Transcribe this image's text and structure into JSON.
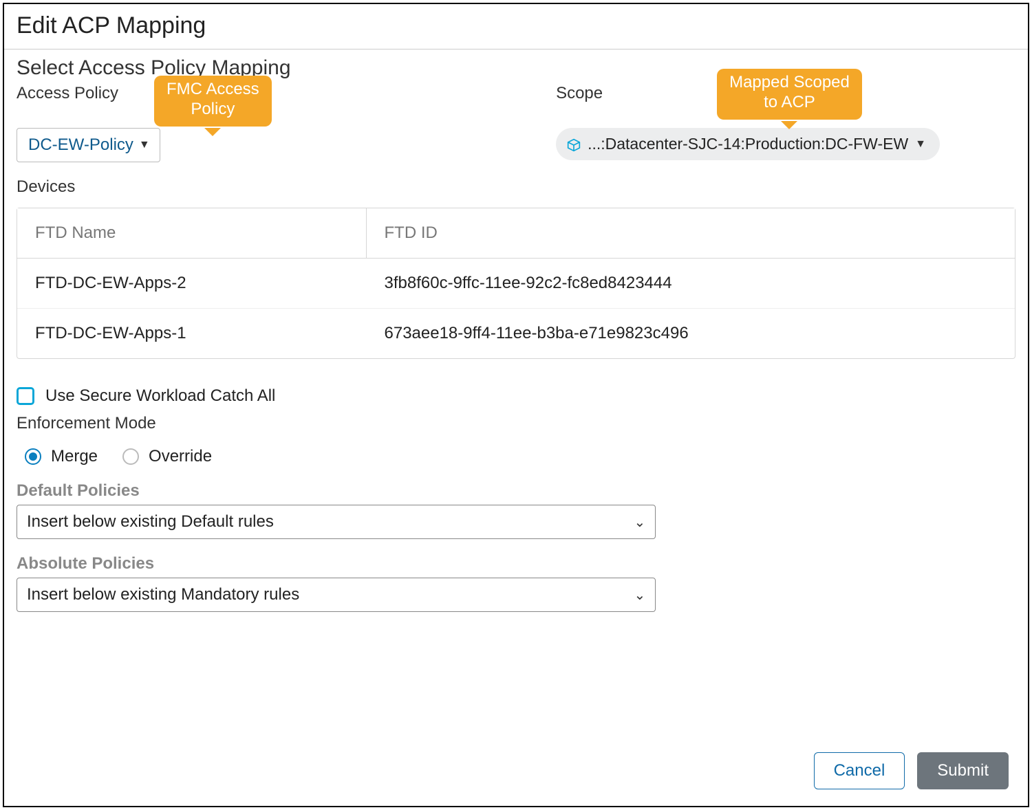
{
  "title": "Edit ACP Mapping",
  "subtitle": "Select Access Policy Mapping",
  "access_policy": {
    "label": "Access Policy",
    "value": "DC-EW-Policy",
    "callout": "FMC Access\nPolicy"
  },
  "scope": {
    "label": "Scope",
    "value": "...:Datacenter-SJC-14:Production:DC-FW-EW",
    "callout": "Mapped Scoped\nto ACP"
  },
  "devices": {
    "label": "Devices",
    "columns": {
      "name": "FTD Name",
      "id": "FTD ID"
    },
    "rows": [
      {
        "name": "FTD-DC-EW-Apps-2",
        "id": "3fb8f60c-9ffc-11ee-92c2-fc8ed8423444"
      },
      {
        "name": "FTD-DC-EW-Apps-1",
        "id": "673aee18-9ff4-11ee-b3ba-e71e9823c496"
      }
    ]
  },
  "catch_all": {
    "label": "Use Secure Workload Catch All",
    "checked": false
  },
  "enforcement": {
    "label": "Enforcement Mode",
    "options": {
      "merge": "Merge",
      "override": "Override"
    },
    "selected": "merge"
  },
  "default_policies": {
    "label": "Default Policies",
    "value": "Insert below existing Default rules"
  },
  "absolute_policies": {
    "label": "Absolute Policies",
    "value": "Insert below existing Mandatory rules"
  },
  "buttons": {
    "cancel": "Cancel",
    "submit": "Submit"
  }
}
